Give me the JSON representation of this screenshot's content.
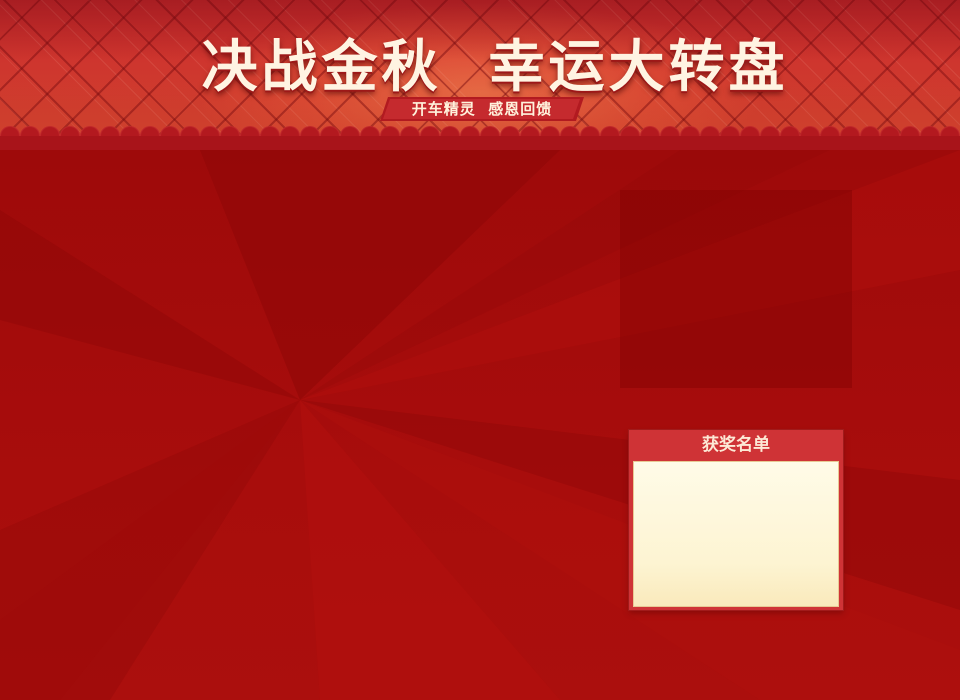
{
  "header": {
    "title": "决战金秋  幸运大转盘",
    "subtitle": "开车精灵  感恩回馈"
  },
  "winners": {
    "title": "获奖名单",
    "entries": []
  },
  "colors": {
    "page_background": "#a60b0b",
    "header_red": "#d23a2f",
    "title_text": "#fff4e2",
    "ribbon": "#c0232a",
    "panel_border": "#cf3336",
    "list_background": "#fffbe8"
  },
  "icons": [
    "scallop-border-decoration",
    "light-rays-background"
  ]
}
